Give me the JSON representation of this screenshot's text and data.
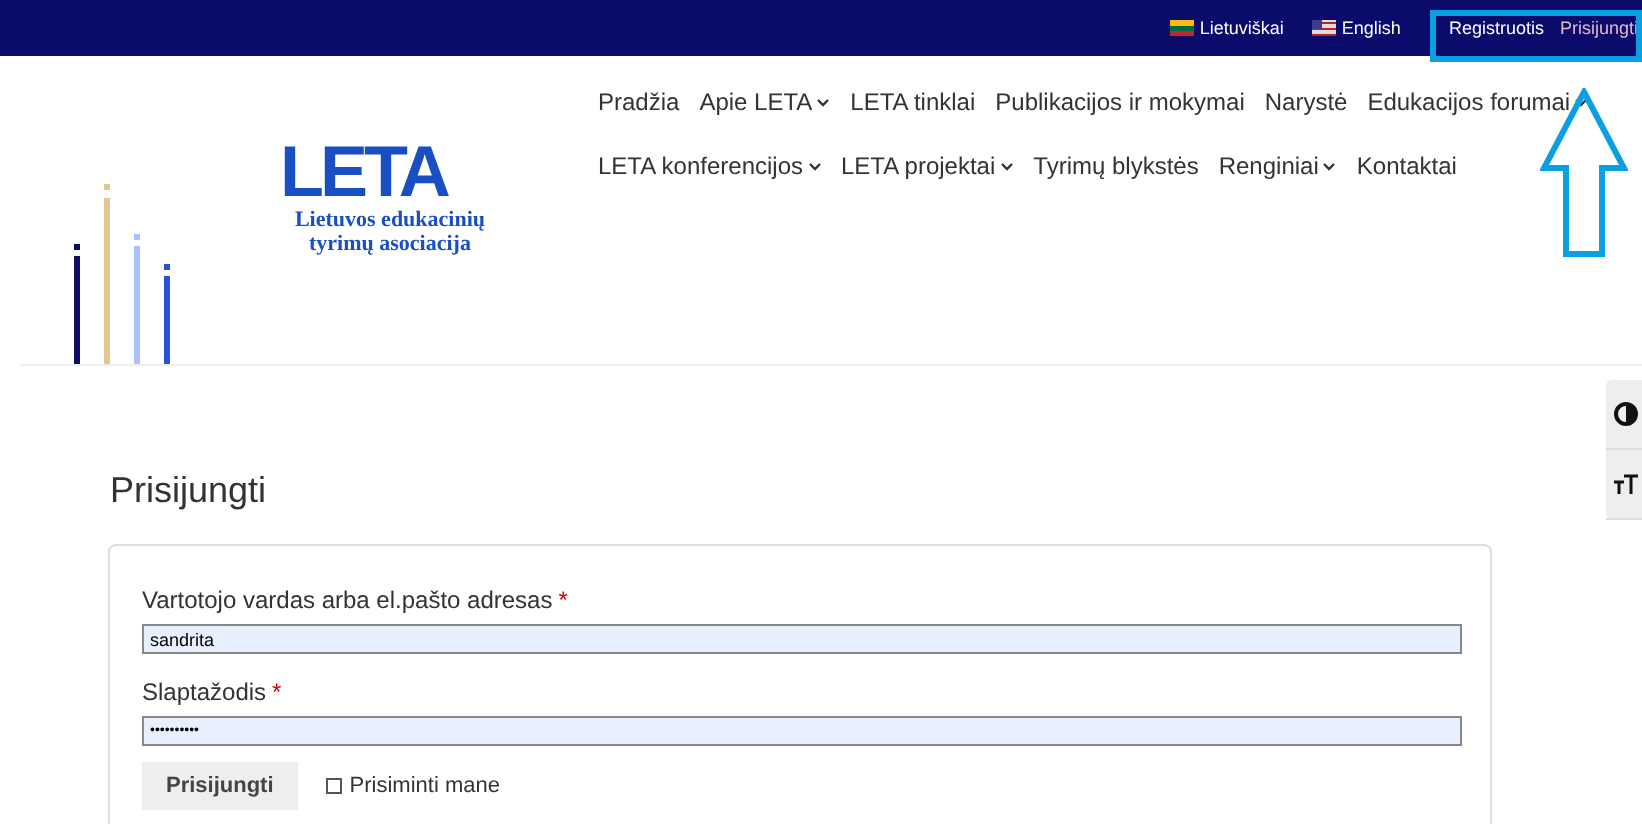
{
  "top_bar": {
    "languages": [
      {
        "label": "Lietuviškai",
        "kind": "lt"
      },
      {
        "label": "English",
        "kind": "us"
      }
    ],
    "account_links": [
      {
        "label": "Registruotis",
        "selected": false
      },
      {
        "label": "Prisijungti",
        "selected": true
      }
    ]
  },
  "logo": {
    "wordmark": "LETA",
    "subtitle": "Lietuvos edukacinių tyrimų asociacija"
  },
  "nav": {
    "upper_links": [
      {
        "label": "Pradžia",
        "dropdown": false
      },
      {
        "label": "Apie LETA",
        "dropdown": true
      },
      {
        "label": "LETA tinklai",
        "dropdown": false
      },
      {
        "label": "Publikacijos ir mokymai",
        "dropdown": false
      },
      {
        "label": "Narystė",
        "dropdown": false
      },
      {
        "label": "Edukacijos forumai",
        "dropdown": true
      }
    ],
    "lower_links": [
      {
        "label": "LETA konferencijos",
        "dropdown": true
      },
      {
        "label": "LETA projektai",
        "dropdown": true
      },
      {
        "label": "Tyrimų blykstės",
        "dropdown": false
      },
      {
        "label": "Renginiai",
        "dropdown": true
      },
      {
        "label": "Kontaktai",
        "dropdown": false
      }
    ]
  },
  "page_title": "Prisijungti",
  "form": {
    "fields": [
      {
        "label": "Vartotojo vardas arba el.pašto adresas",
        "required_mark": "*",
        "value": "sandrita",
        "kind": "text"
      },
      {
        "label": "Slaptažodis",
        "required_mark": "*",
        "value": "••••••••••",
        "kind": "password"
      }
    ],
    "submit": "Prisijungti",
    "remember": {
      "label": "Prisiminti mane",
      "checked": false
    }
  },
  "annotation": {
    "highlight": true,
    "arrow": true
  }
}
